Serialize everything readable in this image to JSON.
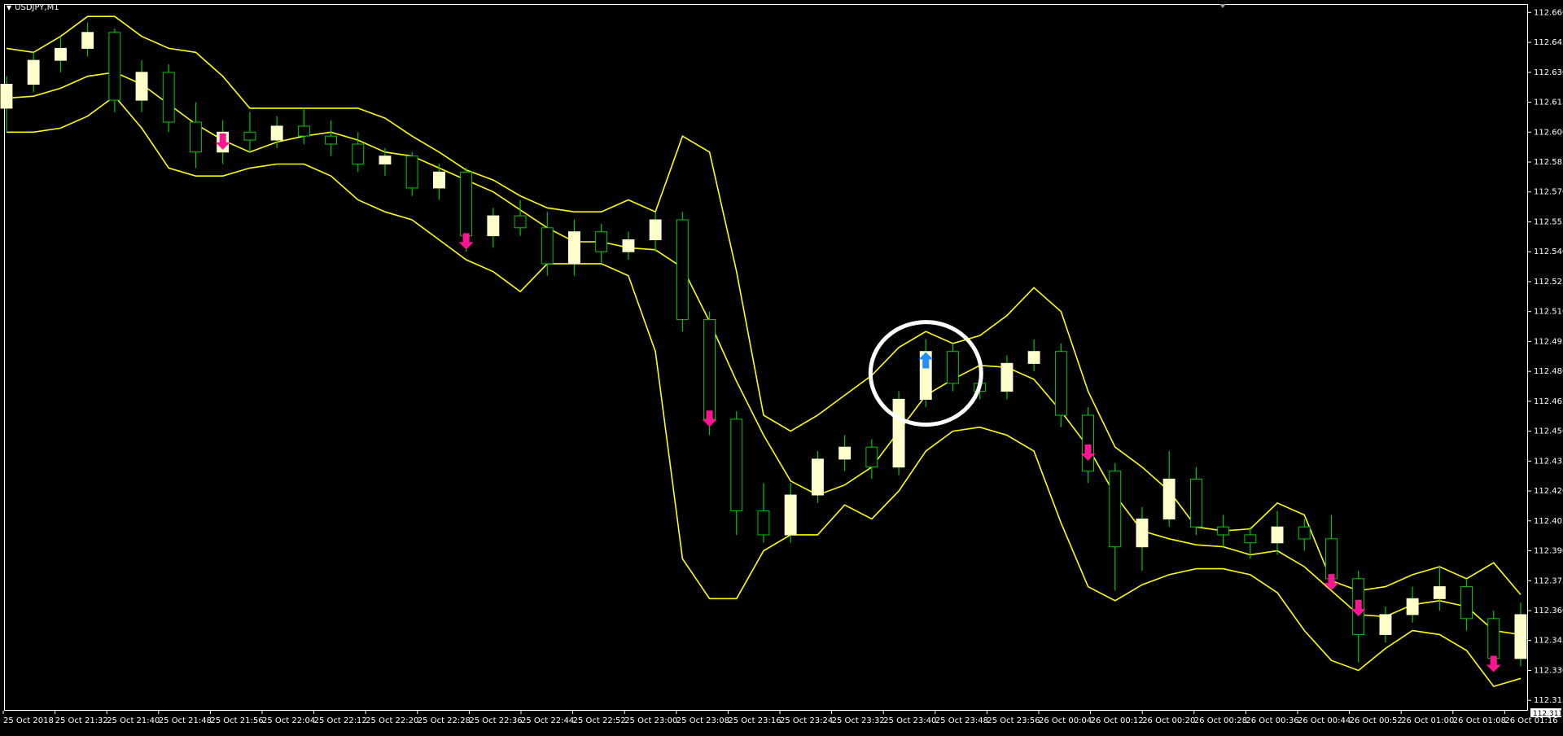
{
  "window": {
    "symbol_label": "USDJPY,M1",
    "last_price_label": "112.311"
  },
  "colors": {
    "background": "#000000",
    "frame": "#ffffff",
    "bull_candle": "#ffffcc",
    "bear_wick": "#00c800",
    "bollinger": "#ffff00",
    "sell_arrow": "#ff1493",
    "buy_arrow": "#1e90ff",
    "highlight_circle": "#ffffff"
  },
  "chart_data": {
    "type": "candlestick",
    "ylim": [
      112.311,
      112.663
    ],
    "y_ticks": [
      "112.660",
      "112.645",
      "112.630",
      "112.615",
      "112.600",
      "112.585",
      "112.570",
      "112.555",
      "112.540",
      "112.525",
      "112.510",
      "112.495",
      "112.480",
      "112.465",
      "112.450",
      "112.435",
      "112.420",
      "112.405",
      "112.390",
      "112.375",
      "112.360",
      "112.345",
      "112.330",
      "112.315"
    ],
    "x_ticks": [
      "25 Oct 2018",
      "25 Oct 21:32",
      "25 Oct 21:40",
      "25 Oct 21:48",
      "25 Oct 21:56",
      "25 Oct 22:04",
      "25 Oct 22:12",
      "25 Oct 22:20",
      "25 Oct 22:28",
      "25 Oct 22:36",
      "25 Oct 22:44",
      "25 Oct 22:52",
      "25 Oct 23:00",
      "25 Oct 23:08",
      "25 Oct 23:16",
      "25 Oct 23:24",
      "25 Oct 23:32",
      "25 Oct 23:40",
      "25 Oct 23:48",
      "25 Oct 23:56",
      "26 Oct 00:04",
      "26 Oct 00:12",
      "26 Oct 00:20",
      "26 Oct 00:28",
      "26 Oct 00:36",
      "26 Oct 00:44",
      "26 Oct 00:52",
      "26 Oct 01:00",
      "26 Oct 01:08",
      "26 Oct 01:16"
    ],
    "bollinger_middle": [
      112.617,
      112.618,
      112.622,
      112.628,
      112.63,
      112.624,
      112.614,
      112.604,
      112.596,
      112.59,
      112.595,
      112.598,
      112.6,
      112.596,
      112.59,
      112.588,
      112.582,
      112.576,
      112.57,
      112.561,
      112.552,
      112.545,
      112.545,
      112.542,
      112.541,
      112.532,
      112.505,
      112.475,
      112.448,
      112.425,
      112.418,
      112.423,
      112.432,
      112.45,
      112.468,
      112.476,
      112.483,
      112.482,
      112.476,
      112.46,
      112.442,
      112.418,
      112.4,
      112.396,
      112.393,
      112.392,
      112.388,
      112.39,
      112.382,
      112.37,
      112.358,
      112.357,
      112.363,
      112.365,
      112.362,
      112.35,
      112.348
    ],
    "bollinger_upper": [
      112.642,
      112.64,
      112.648,
      112.658,
      112.658,
      112.648,
      112.642,
      112.64,
      112.628,
      112.612,
      112.612,
      112.612,
      112.612,
      112.612,
      112.607,
      112.598,
      112.59,
      112.581,
      112.576,
      112.568,
      112.562,
      112.56,
      112.56,
      112.566,
      112.56,
      112.598,
      112.59,
      112.53,
      112.458,
      112.45,
      112.458,
      112.468,
      112.478,
      112.492,
      112.5,
      112.494,
      112.498,
      112.508,
      112.522,
      112.51,
      112.47,
      112.442,
      112.432,
      112.42,
      112.402,
      112.4,
      112.401,
      112.414,
      112.408,
      112.375,
      112.37,
      112.372,
      112.378,
      112.382,
      112.376,
      112.384,
      112.368
    ],
    "bollinger_lower": [
      112.6,
      112.6,
      112.602,
      112.608,
      112.618,
      112.602,
      112.582,
      112.578,
      112.578,
      112.582,
      112.584,
      112.584,
      112.578,
      112.566,
      112.56,
      112.556,
      112.546,
      112.536,
      112.53,
      112.52,
      112.534,
      112.534,
      112.534,
      112.528,
      112.49,
      112.386,
      112.366,
      112.366,
      112.39,
      112.398,
      112.398,
      112.413,
      112.406,
      112.42,
      112.44,
      112.45,
      112.452,
      112.448,
      112.44,
      112.404,
      112.372,
      112.365,
      112.373,
      112.378,
      112.381,
      112.381,
      112.378,
      112.369,
      112.35,
      112.335,
      112.33,
      112.341,
      112.35,
      112.348,
      112.34,
      112.322,
      112.326
    ],
    "candles": [
      {
        "o": 112.612,
        "h": 112.628,
        "l": 112.6,
        "c": 112.624
      },
      {
        "o": 112.624,
        "h": 112.64,
        "l": 112.62,
        "c": 112.636
      },
      {
        "o": 112.636,
        "h": 112.648,
        "l": 112.63,
        "c": 112.642
      },
      {
        "o": 112.642,
        "h": 112.655,
        "l": 112.638,
        "c": 112.65
      },
      {
        "o": 112.65,
        "h": 112.652,
        "l": 112.61,
        "c": 112.616
      },
      {
        "o": 112.616,
        "h": 112.636,
        "l": 112.61,
        "c": 112.63
      },
      {
        "o": 112.63,
        "h": 112.634,
        "l": 112.6,
        "c": 112.605
      },
      {
        "o": 112.605,
        "h": 112.615,
        "l": 112.582,
        "c": 112.59
      },
      {
        "o": 112.59,
        "h": 112.606,
        "l": 112.584,
        "c": 112.6
      },
      {
        "o": 112.6,
        "h": 112.61,
        "l": 112.59,
        "c": 112.596
      },
      {
        "o": 112.596,
        "h": 112.608,
        "l": 112.592,
        "c": 112.603
      },
      {
        "o": 112.603,
        "h": 112.612,
        "l": 112.594,
        "c": 112.598
      },
      {
        "o": 112.598,
        "h": 112.606,
        "l": 112.588,
        "c": 112.594
      },
      {
        "o": 112.594,
        "h": 112.6,
        "l": 112.58,
        "c": 112.584
      },
      {
        "o": 112.584,
        "h": 112.592,
        "l": 112.578,
        "c": 112.588
      },
      {
        "o": 112.588,
        "h": 112.59,
        "l": 112.568,
        "c": 112.572
      },
      {
        "o": 112.572,
        "h": 112.584,
        "l": 112.566,
        "c": 112.58
      },
      {
        "o": 112.58,
        "h": 112.582,
        "l": 112.54,
        "c": 112.548
      },
      {
        "o": 112.548,
        "h": 112.562,
        "l": 112.542,
        "c": 112.558
      },
      {
        "o": 112.558,
        "h": 112.566,
        "l": 112.548,
        "c": 112.552
      },
      {
        "o": 112.552,
        "h": 112.56,
        "l": 112.528,
        "c": 112.534
      },
      {
        "o": 112.534,
        "h": 112.556,
        "l": 112.528,
        "c": 112.55
      },
      {
        "o": 112.55,
        "h": 112.554,
        "l": 112.534,
        "c": 112.54
      },
      {
        "o": 112.54,
        "h": 112.55,
        "l": 112.536,
        "c": 112.546
      },
      {
        "o": 112.546,
        "h": 112.56,
        "l": 112.54,
        "c": 112.556
      },
      {
        "o": 112.556,
        "h": 112.56,
        "l": 112.5,
        "c": 112.506
      },
      {
        "o": 112.506,
        "h": 112.51,
        "l": 112.448,
        "c": 112.456
      },
      {
        "o": 112.456,
        "h": 112.46,
        "l": 112.398,
        "c": 112.41
      },
      {
        "o": 112.41,
        "h": 112.424,
        "l": 112.394,
        "c": 112.398
      },
      {
        "o": 112.398,
        "h": 112.424,
        "l": 112.394,
        "c": 112.418
      },
      {
        "o": 112.418,
        "h": 112.44,
        "l": 112.414,
        "c": 112.436
      },
      {
        "o": 112.436,
        "h": 112.448,
        "l": 112.43,
        "c": 112.442
      },
      {
        "o": 112.442,
        "h": 112.446,
        "l": 112.426,
        "c": 112.432
      },
      {
        "o": 112.432,
        "h": 112.47,
        "l": 112.428,
        "c": 112.466
      },
      {
        "o": 112.466,
        "h": 112.496,
        "l": 112.462,
        "c": 112.49
      },
      {
        "o": 112.49,
        "h": 112.494,
        "l": 112.47,
        "c": 112.474
      },
      {
        "o": 112.474,
        "h": 112.478,
        "l": 112.466,
        "c": 112.47
      },
      {
        "o": 112.47,
        "h": 112.488,
        "l": 112.466,
        "c": 112.484
      },
      {
        "o": 112.484,
        "h": 112.496,
        "l": 112.48,
        "c": 112.49
      },
      {
        "o": 112.49,
        "h": 112.494,
        "l": 112.452,
        "c": 112.458
      },
      {
        "o": 112.458,
        "h": 112.462,
        "l": 112.424,
        "c": 112.43
      },
      {
        "o": 112.43,
        "h": 112.434,
        "l": 112.37,
        "c": 112.392
      },
      {
        "o": 112.392,
        "h": 112.412,
        "l": 112.38,
        "c": 112.406
      },
      {
        "o": 112.406,
        "h": 112.44,
        "l": 112.402,
        "c": 112.426
      },
      {
        "o": 112.426,
        "h": 112.432,
        "l": 112.398,
        "c": 112.402
      },
      {
        "o": 112.402,
        "h": 112.408,
        "l": 112.392,
        "c": 112.398
      },
      {
        "o": 112.398,
        "h": 112.402,
        "l": 112.386,
        "c": 112.394
      },
      {
        "o": 112.394,
        "h": 112.41,
        "l": 112.388,
        "c": 112.402
      },
      {
        "o": 112.402,
        "h": 112.406,
        "l": 112.39,
        "c": 112.396
      },
      {
        "o": 112.396,
        "h": 112.408,
        "l": 112.372,
        "c": 112.376
      },
      {
        "o": 112.376,
        "h": 112.38,
        "l": 112.334,
        "c": 112.348
      },
      {
        "o": 112.348,
        "h": 112.362,
        "l": 112.344,
        "c": 112.358
      },
      {
        "o": 112.358,
        "h": 112.372,
        "l": 112.354,
        "c": 112.366
      },
      {
        "o": 112.366,
        "h": 112.382,
        "l": 112.36,
        "c": 112.372
      },
      {
        "o": 112.372,
        "h": 112.376,
        "l": 112.35,
        "c": 112.356
      },
      {
        "o": 112.356,
        "h": 112.36,
        "l": 112.33,
        "c": 112.336
      },
      {
        "o": 112.336,
        "h": 112.364,
        "l": 112.332,
        "c": 112.358
      }
    ],
    "sell_signals": [
      {
        "i": 8,
        "price": 112.592
      },
      {
        "i": 17,
        "price": 112.542
      },
      {
        "i": 26,
        "price": 112.453
      },
      {
        "i": 40,
        "price": 112.436
      },
      {
        "i": 49,
        "price": 112.371
      },
      {
        "i": 50,
        "price": 112.358
      },
      {
        "i": 55,
        "price": 112.33
      }
    ],
    "buy_signals": [
      {
        "i": 34,
        "price": 112.488
      }
    ],
    "highlight": {
      "i": 34,
      "price": 112.479
    }
  }
}
